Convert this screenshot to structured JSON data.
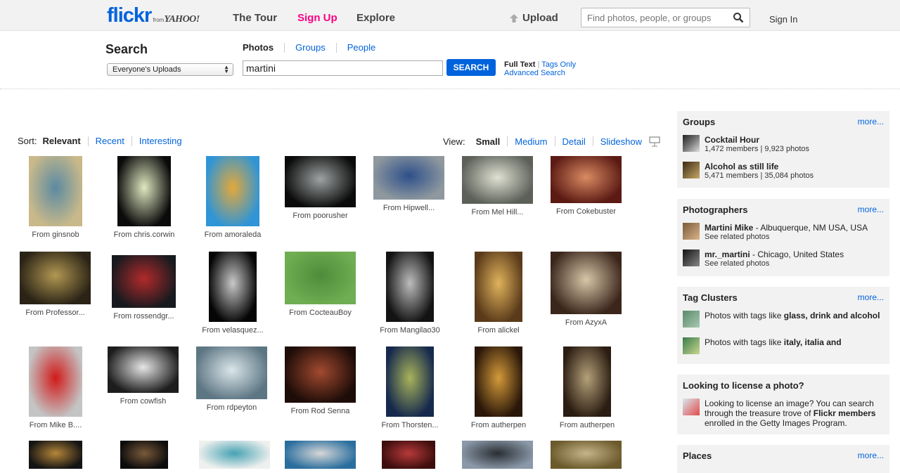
{
  "header": {
    "logo_text": "flickr",
    "logo_from": "from",
    "logo_yahoo": "YAHOO!",
    "nav": [
      "The Tour",
      "Sign Up",
      "Explore"
    ],
    "upload": "Upload",
    "search_placeholder": "Find photos, people, or groups",
    "signin": "Sign In"
  },
  "search": {
    "heading": "Search",
    "scope": "Everyone's Uploads",
    "tabs": [
      "Photos",
      "Groups",
      "People"
    ],
    "query": "martini",
    "button": "SEARCH",
    "full_text": "Full Text",
    "tags_only": "Tags Only",
    "advanced": "Advanced Search"
  },
  "sort": {
    "label": "Sort:",
    "options": [
      "Relevant",
      "Recent",
      "Interesting"
    ]
  },
  "view": {
    "label": "View:",
    "options": [
      "Small",
      "Medium",
      "Detail",
      "Slideshow"
    ]
  },
  "photos": [
    {
      "caption": "From ginsnob",
      "colors": [
        "#c9b98a",
        "#5b8aa2"
      ]
    },
    {
      "caption": "From chris.corwin",
      "colors": [
        "#0b0b0b",
        "#dfe8c0"
      ]
    },
    {
      "caption": "From amoraleda",
      "colors": [
        "#2f95d6",
        "#e4a83a"
      ]
    },
    {
      "caption": "From poorusher",
      "colors": [
        "#0a0a0a",
        "#9fa3a3"
      ]
    },
    {
      "caption": "From Hipwell...",
      "colors": [
        "#8e989e",
        "#2d4f8a"
      ]
    },
    {
      "caption": "From Mel Hill...",
      "colors": [
        "#5d6059",
        "#dfe2d2"
      ]
    },
    {
      "caption": "From Cokebuster",
      "colors": [
        "#5c1a14",
        "#d98b62"
      ]
    },
    {
      "caption": "From Professor...",
      "colors": [
        "#2a2316",
        "#b29852"
      ]
    },
    {
      "caption": "From rossendgr...",
      "colors": [
        "#171a1f",
        "#b22a2a"
      ]
    },
    {
      "caption": "From velasquez...",
      "colors": [
        "#050505",
        "#c9c9c9"
      ]
    },
    {
      "caption": "From CocteauBoy",
      "colors": [
        "#6fae52",
        "#4f8c3a"
      ]
    },
    {
      "caption": "From Mangilao30",
      "colors": [
        "#131313",
        "#bdbdbd"
      ]
    },
    {
      "caption": "From alickel",
      "colors": [
        "#5a3a1a",
        "#e0b35c"
      ]
    },
    {
      "caption": "From AzyxA",
      "colors": [
        "#3b261c",
        "#d7c7a8"
      ]
    },
    {
      "caption": "From Mike B....",
      "colors": [
        "#c4c4c4",
        "#d11a1a"
      ]
    },
    {
      "caption": "From cowfish",
      "colors": [
        "#1d1d1d",
        "#e6e6e6"
      ]
    },
    {
      "caption": "From rdpeyton",
      "colors": [
        "#5d7683",
        "#dbe6ea"
      ]
    },
    {
      "caption": "From Rod Senna",
      "colors": [
        "#1d0c08",
        "#a24a2f"
      ]
    },
    {
      "caption": "From Thorsten...",
      "colors": [
        "#16294d",
        "#a8b35a"
      ]
    },
    {
      "caption": "From autherpen",
      "colors": [
        "#2a1709",
        "#d49a3a"
      ]
    },
    {
      "caption": "From autherpen",
      "colors": [
        "#2b1d12",
        "#b4a079"
      ]
    },
    {
      "caption": "",
      "colors": [
        "#141414",
        "#b68638"
      ]
    },
    {
      "caption": "",
      "colors": [
        "#0c0c0c",
        "#7a5a3a"
      ]
    },
    {
      "caption": "",
      "colors": [
        "#eef0ee",
        "#46a2b3"
      ]
    },
    {
      "caption": "",
      "colors": [
        "#2a6e9e",
        "#d7d7d7"
      ]
    },
    {
      "caption": "",
      "colors": [
        "#3e0d0d",
        "#b73a3a"
      ]
    },
    {
      "caption": "",
      "colors": [
        "#8a98a8",
        "#2a2e33"
      ]
    },
    {
      "caption": "",
      "colors": [
        "#6b5a2b",
        "#c6b58a"
      ]
    }
  ],
  "groups": {
    "title": "Groups",
    "more": "more...",
    "items": [
      {
        "name": "Cocktail Hour",
        "meta": "1,472 members | 9,923 photos"
      },
      {
        "name": "Alcohol as still life",
        "meta": "5,471 members | 35,084 photos"
      }
    ]
  },
  "photographers": {
    "title": "Photographers",
    "more": "more...",
    "items": [
      {
        "name": "Martini Mike",
        "loc": " - Albuquerque, NM USA, USA",
        "see": "See related photos"
      },
      {
        "name": "mr._martini",
        "loc": " - Chicago, United States",
        "see": "See related photos"
      }
    ]
  },
  "tag_clusters": {
    "title": "Tag Clusters",
    "more": "more...",
    "items": [
      {
        "prefix": "Photos with tags like ",
        "tags": "glass, drink and alcohol"
      },
      {
        "prefix": "Photos with tags like ",
        "tags": "italy, italia and"
      }
    ]
  },
  "license": {
    "title": "Looking to license a photo?",
    "text1": "Looking to license an image? You can search through the treasure trove of ",
    "bold": "Flickr members",
    "text2": " enrolled in the Getty Images Program."
  },
  "places": {
    "title": "Places",
    "more": "more..."
  }
}
